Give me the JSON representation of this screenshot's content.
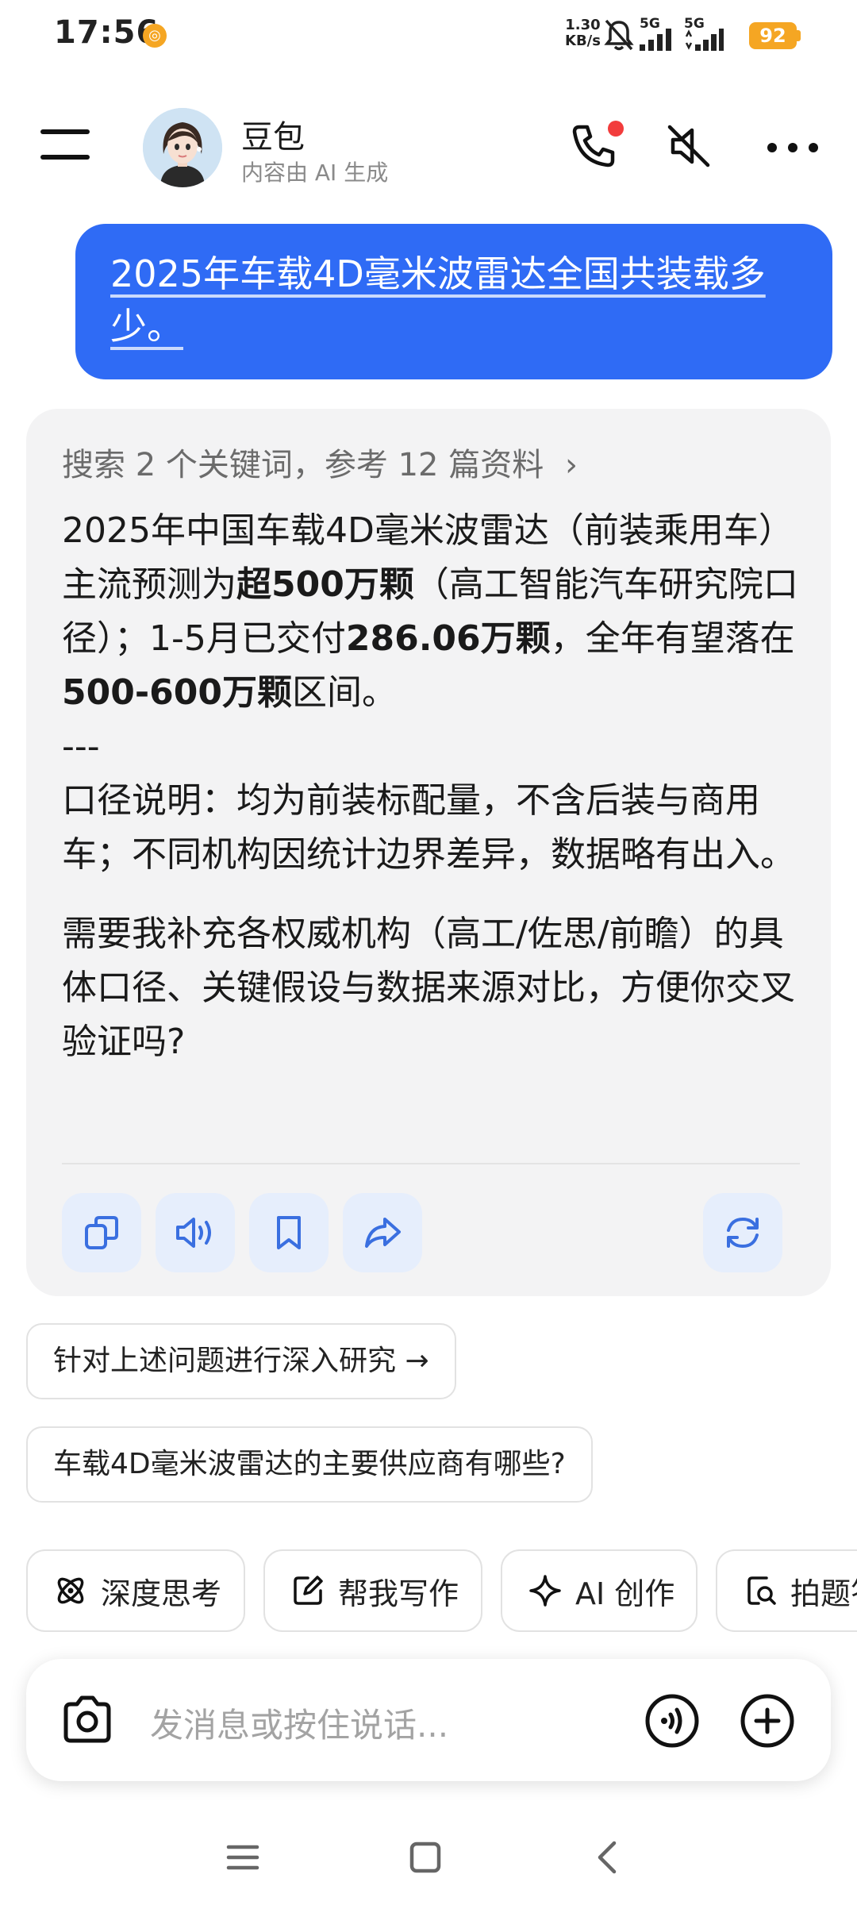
{
  "status_bar": {
    "time": "17:56",
    "net_speed_value": "1.30",
    "net_speed_unit": "KB/s",
    "signal_1": "5G",
    "signal_2": "5G",
    "battery": "92"
  },
  "header": {
    "bot_name": "豆包",
    "subtitle": "内容由 AI 生成"
  },
  "user_message": "2025年车载4D毫米波雷达全国共装载多少。",
  "answer": {
    "search_summary": "搜索 2 个关键词，参考 12 篇资料",
    "p1_a": "2025年中国车载4D毫米波雷达（前装乘用车）主流预测为",
    "p1_b": "超500万颗",
    "p1_c": "（高工智能汽车研究院口径）；1-5月已交付",
    "p1_d": "286.06万颗",
    "p1_e": "，全年有望落在",
    "p1_f": "500-600万颗",
    "p1_g": "区间。",
    "separator": "---",
    "p2": "口径说明：均为前装标配量，不含后装与商用车；不同机构因统计边界差异，数据略有出入。",
    "p3": "需要我补充各权威机构（高工/佐思/前瞻）的具体口径、关键假设与数据来源对比，方便你交叉验证吗?"
  },
  "suggestions": [
    {
      "label": "针对上述问题进行深入研究 →"
    },
    {
      "label": "车载4D毫米波雷达的主要供应商有哪些?"
    }
  ],
  "tools": [
    {
      "label": "深度思考",
      "icon": "atom-icon"
    },
    {
      "label": "帮我写作",
      "icon": "edit-icon"
    },
    {
      "label": "AI 创作",
      "icon": "sparkle-icon"
    },
    {
      "label": "拍题答",
      "icon": "scan-question-icon"
    }
  ],
  "input": {
    "placeholder": "发消息或按住说话..."
  },
  "colors": {
    "accent": "#2f6bf5",
    "card_bg": "#f3f3f4",
    "action_bg": "#e6eefc",
    "battery": "#f5a623"
  }
}
